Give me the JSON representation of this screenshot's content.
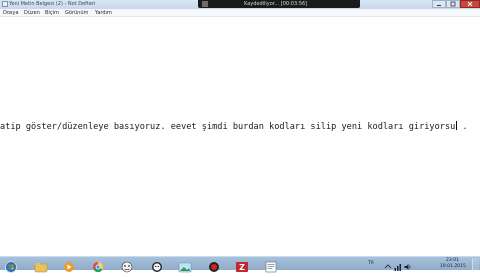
{
  "window": {
    "title": "Yeni Metin Belgesi (2) - Not Defteri"
  },
  "recorder": {
    "status": "Kaydediliyor... [00:03:56]"
  },
  "menu": {
    "items": [
      "Dosya",
      "Düzen",
      "Biçim",
      "Görünüm",
      "Yardım"
    ]
  },
  "editor": {
    "text": "atip göster/düzenleye basıyoruz. eevet şimdi burdan kodları silip yeni kodları giriyorsu",
    "trailing": "."
  },
  "taskbar": {
    "lang": "TR",
    "time": "23:01",
    "date": "19.01.2015",
    "icons": [
      "start-orb-icon",
      "folder-icon",
      "media-player-icon",
      "chrome-icon",
      "anonymous-mask-icon",
      "anonymous-mask-icon",
      "photo-viewer-icon",
      "record-icon",
      "filezilla-icon",
      "hosts-file-icon"
    ]
  },
  "colors": {
    "titlebar": "#c6d8ec",
    "taskbar": "#8fabc9",
    "recorder_bg": "#1b1b1b",
    "close_button": "#c9463d"
  }
}
